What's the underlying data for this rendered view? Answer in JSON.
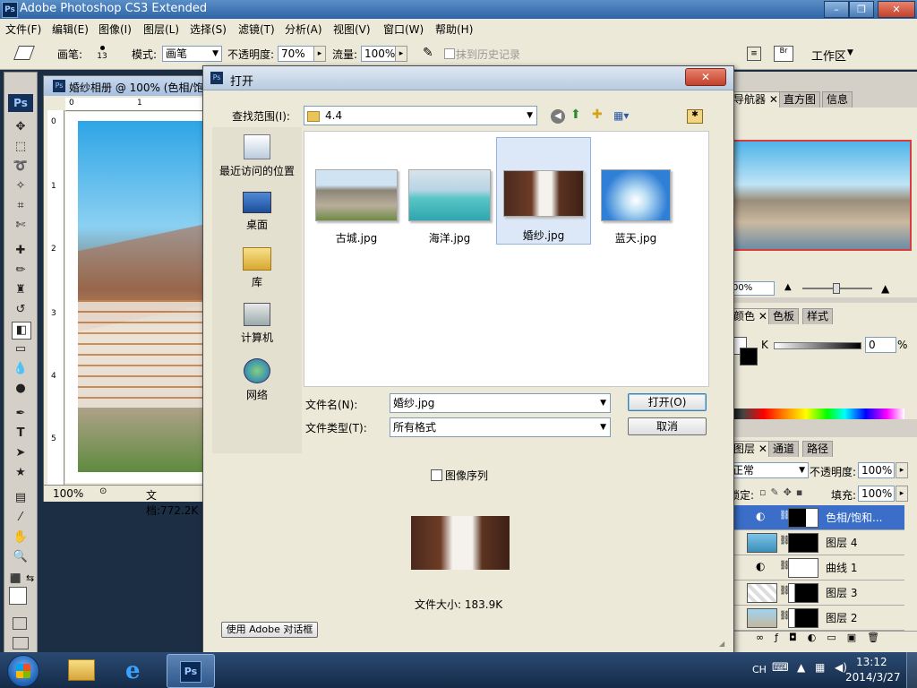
{
  "app": {
    "title": "Adobe Photoshop CS3 Extended"
  },
  "menu": [
    "文件(F)",
    "编辑(E)",
    "图像(I)",
    "图层(L)",
    "选择(S)",
    "滤镜(T)",
    "分析(A)",
    "视图(V)",
    "窗口(W)",
    "帮助(H)"
  ],
  "options": {
    "brush_label": "画笔:",
    "brush_size": "13",
    "mode_label": "模式:",
    "mode_value": "画笔",
    "opacity_label": "不透明度:",
    "opacity_value": "70%",
    "flow_label": "流量:",
    "flow_value": "100%",
    "history_label": "抹到历史记录",
    "workspace_label": "工作区"
  },
  "document": {
    "title": "婚纱相册 @ 100% (色相/饱",
    "zoom": "100%",
    "doc_size": "文档:772.2K",
    "ruler_top": [
      "0",
      "1"
    ],
    "ruler_left": [
      "0",
      "1",
      "2",
      "3",
      "4",
      "5"
    ]
  },
  "dialog": {
    "title": "打开",
    "look_in_label": "查找范围(I):",
    "look_in_value": "4.4",
    "places": [
      "最近访问的位置",
      "桌面",
      "库",
      "计算机",
      "网络"
    ],
    "files": [
      {
        "name": "古城.jpg"
      },
      {
        "name": "海洋.jpg"
      },
      {
        "name": "婚纱.jpg"
      },
      {
        "name": "蓝天.jpg"
      }
    ],
    "filename_label": "文件名(N):",
    "filename_value": "婚纱.jpg",
    "filetype_label": "文件类型(T):",
    "filetype_value": "所有格式",
    "open_button": "打开(O)",
    "cancel_button": "取消",
    "image_sequence_label": "图像序列",
    "file_size": "文件大小: 183.9K",
    "adobe_dialog_button": "使用 Adobe 对话框"
  },
  "panels": {
    "navigator_tabs": [
      "导航器",
      "直方图",
      "信息"
    ],
    "nav_zoom": "00%",
    "color_tabs": [
      "颜色",
      "色板",
      "样式"
    ],
    "color_k_label": "K",
    "color_k_value": "0",
    "color_k_unit": "%",
    "layers_tabs": [
      "图层",
      "通道",
      "路径"
    ],
    "blend_mode": "正常",
    "layer_opacity_label": "不透明度:",
    "layer_opacity_value": "100%",
    "lock_label": "锁定:",
    "fill_label": "填充:",
    "fill_value": "100%",
    "layers": [
      {
        "name": "色相/饱和..."
      },
      {
        "name": "图层 4"
      },
      {
        "name": "曲线 1"
      },
      {
        "name": "图层 3"
      },
      {
        "name": "图层 2"
      }
    ]
  },
  "taskbar": {
    "lang": "CH",
    "time": "13:12",
    "date": "2014/3/27"
  }
}
